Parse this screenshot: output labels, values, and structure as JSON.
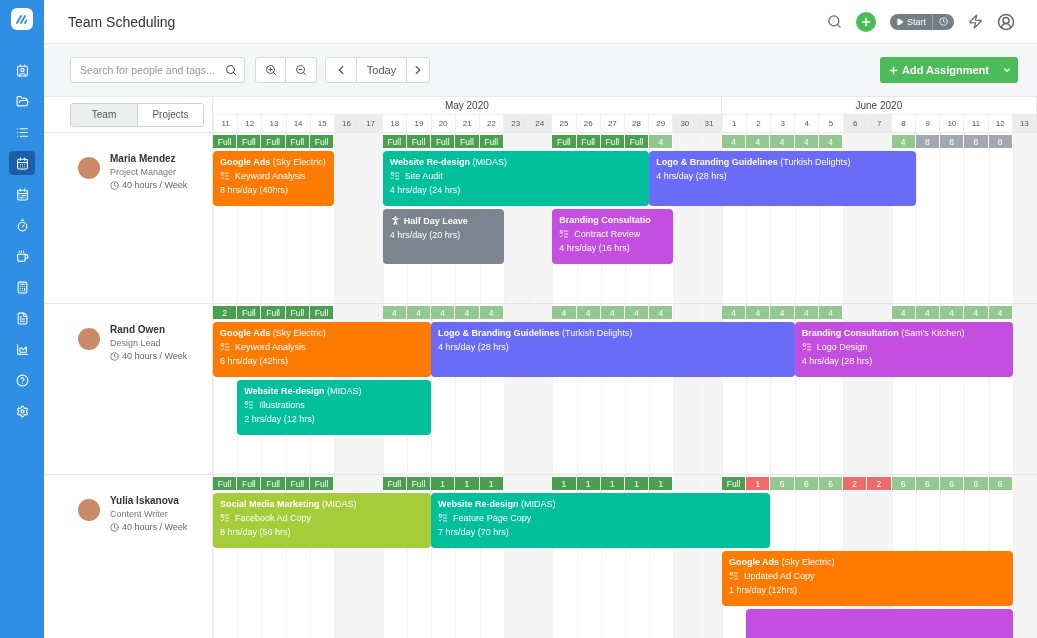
{
  "sidebar": {
    "items": [
      {
        "selected": false
      },
      {
        "selected": false
      },
      {
        "selected": false
      },
      {
        "selected": true
      },
      {
        "selected": false
      },
      {
        "selected": false
      },
      {
        "selected": false
      },
      {
        "selected": false
      },
      {
        "selected": false
      },
      {
        "selected": false
      },
      {
        "selected": false
      },
      {
        "selected": false
      }
    ]
  },
  "header": {
    "title": "Team Scheduling",
    "timer_label": "Start"
  },
  "toolbar": {
    "search": {
      "placeholder": "Search for people and tags..."
    },
    "today_label": "Today",
    "add_label": "Add Assignment"
  },
  "view_tabs": [
    {
      "label": "Team",
      "selected": true
    },
    {
      "label": "Projects",
      "selected": false
    }
  ],
  "calendar": {
    "months": [
      {
        "label": "May 2020",
        "days": [
          {
            "label": "11",
            "weekend": false
          },
          {
            "label": "12",
            "weekend": false
          },
          {
            "label": "13",
            "weekend": false
          },
          {
            "label": "14",
            "weekend": false
          },
          {
            "label": "15",
            "weekend": false
          },
          {
            "label": "16",
            "weekend": true
          },
          {
            "label": "17",
            "weekend": true
          },
          {
            "label": "18",
            "weekend": false
          },
          {
            "label": "19",
            "weekend": false
          },
          {
            "label": "20",
            "weekend": false
          },
          {
            "label": "21",
            "weekend": false
          },
          {
            "label": "22",
            "weekend": false
          },
          {
            "label": "23",
            "weekend": true
          },
          {
            "label": "24",
            "weekend": true
          },
          {
            "label": "25",
            "weekend": false
          },
          {
            "label": "26",
            "weekend": false
          },
          {
            "label": "27",
            "weekend": false
          },
          {
            "label": "28",
            "weekend": false
          },
          {
            "label": "29",
            "weekend": false
          },
          {
            "label": "30",
            "weekend": true
          },
          {
            "label": "31",
            "weekend": true
          }
        ]
      },
      {
        "label": "June 2020",
        "days": [
          {
            "label": "1",
            "weekend": false
          },
          {
            "label": "2",
            "weekend": false
          },
          {
            "label": "3",
            "weekend": false
          },
          {
            "label": "4",
            "weekend": false
          },
          {
            "label": "5",
            "weekend": false
          },
          {
            "label": "6",
            "weekend": true
          },
          {
            "label": "7",
            "weekend": true
          },
          {
            "label": "8",
            "weekend": false
          },
          {
            "label": "9",
            "weekend": false
          },
          {
            "label": "10",
            "weekend": false
          },
          {
            "label": "11",
            "weekend": false
          },
          {
            "label": "12",
            "weekend": false
          },
          {
            "label": "13",
            "weekend": true
          }
        ]
      }
    ]
  },
  "people": [
    {
      "name": "Maria Mendez",
      "role": "Project Manager",
      "hours": "40 hours / Week",
      "capacity": [
        {
          "kind": "booked",
          "label": "Full"
        },
        {
          "kind": "booked",
          "label": "Full"
        },
        {
          "kind": "booked",
          "label": "Full"
        },
        {
          "kind": "booked",
          "label": "Full"
        },
        {
          "kind": "booked",
          "label": "Full"
        },
        {
          "kind": "none"
        },
        {
          "kind": "none"
        },
        {
          "kind": "booked",
          "label": "Full"
        },
        {
          "kind": "booked",
          "label": "Full"
        },
        {
          "kind": "booked",
          "label": "Full"
        },
        {
          "kind": "booked",
          "label": "Full"
        },
        {
          "kind": "booked",
          "label": "Full"
        },
        {
          "kind": "none"
        },
        {
          "kind": "none"
        },
        {
          "kind": "booked",
          "label": "Full"
        },
        {
          "kind": "booked",
          "label": "Full"
        },
        {
          "kind": "booked",
          "label": "Full"
        },
        {
          "kind": "booked",
          "label": "Full"
        },
        {
          "kind": "partial",
          "label": "4"
        },
        {
          "kind": "none"
        },
        {
          "kind": "none"
        },
        {
          "kind": "partial",
          "label": "4"
        },
        {
          "kind": "partial",
          "label": "4"
        },
        {
          "kind": "partial",
          "label": "4"
        },
        {
          "kind": "partial",
          "label": "4"
        },
        {
          "kind": "partial",
          "label": "4"
        },
        {
          "kind": "none"
        },
        {
          "kind": "none"
        },
        {
          "kind": "partial",
          "label": "4"
        },
        {
          "kind": "free",
          "label": "8"
        },
        {
          "kind": "free",
          "label": "8"
        },
        {
          "kind": "free",
          "label": "8"
        },
        {
          "kind": "free",
          "label": "8"
        },
        {
          "kind": "none"
        }
      ],
      "lanes": [
        [
          {
            "kind": "task",
            "title": "Google Ads",
            "client": "(Sky Electric)",
            "task": "Keyword Analysis",
            "hours": "8 hrs/day (40hrs)",
            "color": "#ff7a00"
          },
          {
            "kind": "task",
            "title": "Website Re-design",
            "client": "(MIDAS)",
            "task": "Site Audit",
            "hours": "4 hrs/day (24 hrs)",
            "color": "#00bf9b"
          },
          {
            "kind": "task",
            "title": "Logo & Branding Guidelines",
            "client": "(Turkish Delights)",
            "hours": "4 hrs/day (28 hrs)",
            "color": "#6a6cf7"
          }
        ],
        [
          {
            "kind": "leave",
            "title": "Half Day Leave",
            "hours": "4 hrs/day (20 hrs)",
            "color": "#7b8590"
          },
          {
            "kind": "task",
            "title": "Branding Consultatio",
            "task": "Contract Review",
            "hours": "4 hrs/day (16 hrs)",
            "color": "#c44ee0"
          }
        ]
      ]
    },
    {
      "name": "Rand Owen",
      "role": "Design Lead",
      "hours": "40 hours / Week",
      "capacity": [
        {
          "kind": "booked",
          "label": "2"
        },
        {
          "kind": "booked",
          "label": "Full"
        },
        {
          "kind": "booked",
          "label": "Full"
        },
        {
          "kind": "booked",
          "label": "Full"
        },
        {
          "kind": "booked",
          "label": "Full"
        },
        {
          "kind": "none"
        },
        {
          "kind": "none"
        },
        {
          "kind": "partial",
          "label": "4"
        },
        {
          "kind": "partial",
          "label": "4"
        },
        {
          "kind": "partial",
          "label": "4"
        },
        {
          "kind": "partial",
          "label": "4"
        },
        {
          "kind": "partial",
          "label": "4"
        },
        {
          "kind": "none"
        },
        {
          "kind": "none"
        },
        {
          "kind": "partial",
          "label": "4"
        },
        {
          "kind": "partial",
          "label": "4"
        },
        {
          "kind": "partial",
          "label": "4"
        },
        {
          "kind": "partial",
          "label": "4"
        },
        {
          "kind": "partial",
          "label": "4"
        },
        {
          "kind": "none"
        },
        {
          "kind": "none"
        },
        {
          "kind": "partial",
          "label": "4"
        },
        {
          "kind": "partial",
          "label": "4"
        },
        {
          "kind": "partial",
          "label": "4"
        },
        {
          "kind": "partial",
          "label": "4"
        },
        {
          "kind": "partial",
          "label": "4"
        },
        {
          "kind": "none"
        },
        {
          "kind": "none"
        },
        {
          "kind": "partial",
          "label": "4"
        },
        {
          "kind": "partial",
          "label": "4"
        },
        {
          "kind": "partial",
          "label": "4"
        },
        {
          "kind": "partial",
          "label": "4"
        },
        {
          "kind": "partial",
          "label": "4"
        },
        {
          "kind": "none"
        }
      ],
      "lanes": [
        [
          {
            "kind": "task",
            "title": "Google Ads",
            "client": "(Sky Electric)",
            "task": "Keyword Analysis",
            "hours": "6 hrs/day (42hrs)",
            "color": "#ff7a00"
          },
          {
            "kind": "task",
            "title": "Logo & Branding Guidelines",
            "client": "(Turkish Delights)",
            "hours": "4 hrs/day (28 hrs)",
            "color": "#6a6cf7"
          },
          {
            "kind": "task",
            "title": "Branding Consultation",
            "client": "(Sam's Kitchen)",
            "task": "Logo Design",
            "hours": "4 hrs/day (28 hrs)",
            "color": "#c44ee0"
          }
        ],
        [
          {
            "kind": "task",
            "title": "Website Re-design",
            "client": "(MIDAS)",
            "task": "Illustrations",
            "hours": "2 hrs/day (12 hrs)",
            "color": "#00bf9b"
          }
        ]
      ]
    },
    {
      "name": "Yulia Iskanova",
      "role": "Content Writer",
      "hours": "40 hours / Week",
      "capacity": [
        {
          "kind": "booked",
          "label": "Full"
        },
        {
          "kind": "booked",
          "label": "Full"
        },
        {
          "kind": "booked",
          "label": "Full"
        },
        {
          "kind": "booked",
          "label": "Full"
        },
        {
          "kind": "booked",
          "label": "Full"
        },
        {
          "kind": "none"
        },
        {
          "kind": "none"
        },
        {
          "kind": "booked",
          "label": "Full"
        },
        {
          "kind": "booked",
          "label": "Full"
        },
        {
          "kind": "booked",
          "label": "1"
        },
        {
          "kind": "booked",
          "label": "1"
        },
        {
          "kind": "booked",
          "label": "1"
        },
        {
          "kind": "none"
        },
        {
          "kind": "none"
        },
        {
          "kind": "booked",
          "label": "1"
        },
        {
          "kind": "booked",
          "label": "1"
        },
        {
          "kind": "booked",
          "label": "1"
        },
        {
          "kind": "booked",
          "label": "1"
        },
        {
          "kind": "booked",
          "label": "1"
        },
        {
          "kind": "none"
        },
        {
          "kind": "none"
        },
        {
          "kind": "booked",
          "label": "Full"
        },
        {
          "kind": "over",
          "label": "1"
        },
        {
          "kind": "partial",
          "label": "6"
        },
        {
          "kind": "partial",
          "label": "6"
        },
        {
          "kind": "partial",
          "label": "6"
        },
        {
          "kind": "over",
          "label": "2"
        },
        {
          "kind": "over",
          "label": "2"
        },
        {
          "kind": "partial",
          "label": "6"
        },
        {
          "kind": "partial",
          "label": "6"
        },
        {
          "kind": "partial",
          "label": "6"
        },
        {
          "kind": "partial",
          "label": "6"
        },
        {
          "kind": "partial",
          "label": "6"
        },
        {
          "kind": "none"
        }
      ],
      "lanes": [
        [
          {
            "kind": "task",
            "title": "Social Media Marketing",
            "client": "(MIDAS)",
            "task": "Facebook Ad Copy",
            "hours": "8 hrs/day (56 hrs)",
            "color": "#a5cd39"
          },
          {
            "kind": "task",
            "title": "Website Re-design",
            "client": "(MIDAS)",
            "task": "Feature Page Copy",
            "hours": "7 hrs/day (70 hrs)",
            "color": "#00bf9b"
          }
        ],
        [
          {
            "kind": "task",
            "title": "Google Ads",
            "client": "(Sky Electric)",
            "task": "Updated Ad Copy",
            "hours": "1 hrs/day (12hrs)",
            "color": "#ff7a00"
          }
        ],
        [
          {
            "kind": "task",
            "color": "#c44ee0"
          }
        ]
      ]
    }
  ]
}
